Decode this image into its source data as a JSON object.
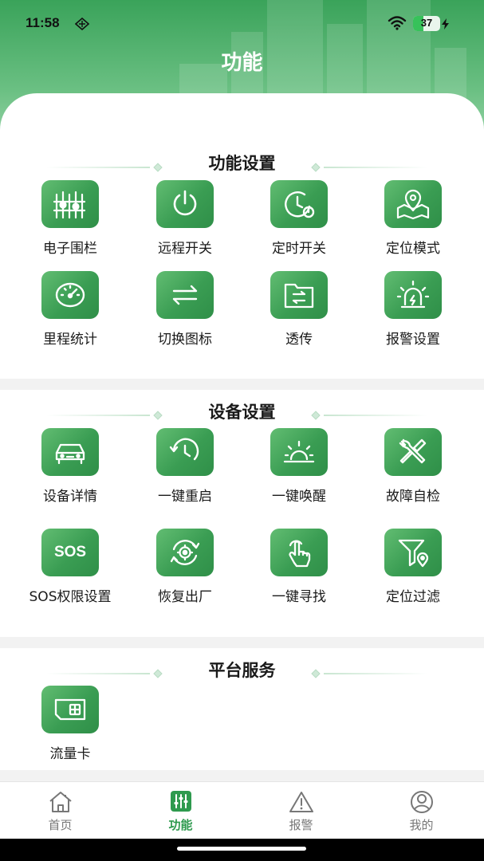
{
  "status_bar": {
    "time": "11:58",
    "battery": "37"
  },
  "header": {
    "title": "功能"
  },
  "sections": [
    {
      "title": "功能设置",
      "items": [
        {
          "label": "电子围栏",
          "icon": "fence-icon"
        },
        {
          "label": "远程开关",
          "icon": "power-icon"
        },
        {
          "label": "定时开关",
          "icon": "timer-power-icon"
        },
        {
          "label": "定位模式",
          "icon": "map-pin-icon"
        },
        {
          "label": "里程统计",
          "icon": "speedometer-icon"
        },
        {
          "label": "切换图标",
          "icon": "switch-arrows-icon"
        },
        {
          "label": "透传",
          "icon": "folder-transfer-icon"
        },
        {
          "label": "报警设置",
          "icon": "alarm-light-icon"
        }
      ]
    },
    {
      "title": "设备设置",
      "items": [
        {
          "label": "设备详情",
          "icon": "car-icon"
        },
        {
          "label": "一键重启",
          "icon": "restart-clock-icon"
        },
        {
          "label": "一键唤醒",
          "icon": "sunrise-icon"
        },
        {
          "label": "故障自检",
          "icon": "tools-icon"
        },
        {
          "label": "SOS权限设置",
          "icon": "sos-icon",
          "text": "SOS"
        },
        {
          "label": "恢复出厂",
          "icon": "factory-reset-gear-icon"
        },
        {
          "label": "一键寻找",
          "icon": "finger-tap-icon"
        },
        {
          "label": "定位过滤",
          "icon": "filter-location-icon"
        }
      ]
    },
    {
      "title": "平台服务",
      "items": [
        {
          "label": "流量卡",
          "icon": "sim-card-icon"
        }
      ]
    }
  ],
  "tabbar": [
    {
      "label": "首页",
      "icon": "home-icon",
      "active": false
    },
    {
      "label": "功能",
      "icon": "function-sliders-icon",
      "active": true
    },
    {
      "label": "报警",
      "icon": "warning-icon",
      "active": false
    },
    {
      "label": "我的",
      "icon": "profile-icon",
      "active": false
    }
  ],
  "colors": {
    "accent": "#2e9a4e",
    "tile_light": "#62bd72",
    "tile_dark": "#2f8f48",
    "header": "#3aa35a"
  }
}
